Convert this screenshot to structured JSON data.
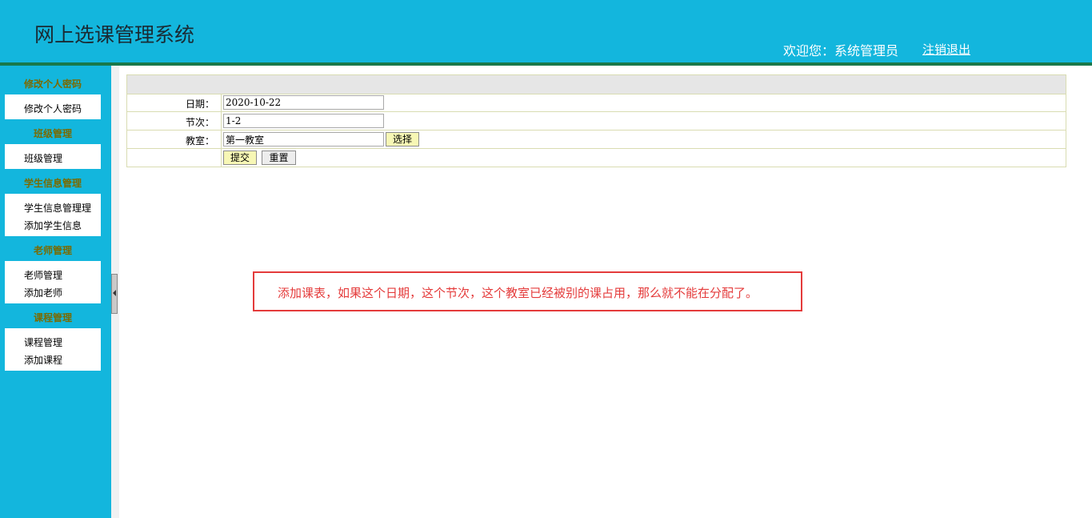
{
  "header": {
    "app_title": "网上选课管理系统",
    "welcome": "欢迎您：系统管理员",
    "logout": "注销退出"
  },
  "sidebar": {
    "groups": [
      {
        "title": "修改个人密码",
        "items": [
          "修改个人密码"
        ]
      },
      {
        "title": "班级管理",
        "items": [
          "班级管理"
        ]
      },
      {
        "title": "学生信息管理",
        "items": [
          "学生信息管理理",
          "添加学生信息"
        ]
      },
      {
        "title": "老师管理",
        "items": [
          "老师管理",
          "添加老师"
        ]
      },
      {
        "title": "课程管理",
        "items": [
          "课程管理",
          "添加课程"
        ]
      }
    ]
  },
  "form": {
    "date_label": "日期：",
    "date_value": "2020-10-22",
    "period_label": "节次：",
    "period_value": "1-2",
    "room_label": "教室：",
    "room_value": "第一教室",
    "select_button": "选择",
    "submit_button": "提交",
    "reset_button": "重置"
  },
  "note": {
    "text": "添加课表，如果这个日期，这个节次，这个教室已经被别的课占用，那么就不能在分配了。"
  },
  "colors": {
    "header_bg": "#13b6dd",
    "header_line": "#19784a",
    "group_title": "#7a6a00",
    "note": "#e43b3b"
  }
}
